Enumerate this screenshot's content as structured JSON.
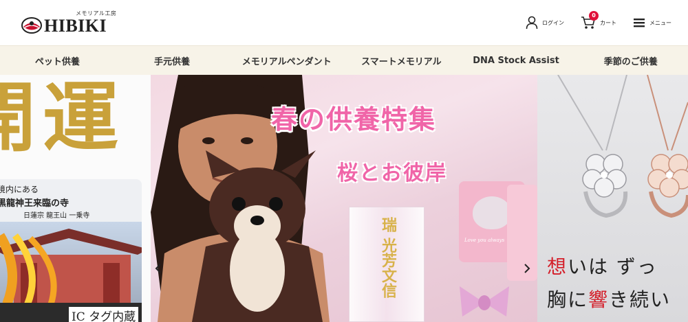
{
  "header": {
    "logo_sub": "メモリアル工房",
    "logo_text": "HIBIKI",
    "login_label": "ログイン",
    "cart_label": "カート",
    "cart_count": "0",
    "menu_label": "メニュー",
    "icons": {
      "login": "user-icon",
      "cart": "cart-icon",
      "menu": "hamburger-icon"
    },
    "accent_color": "#e0103a"
  },
  "nav": {
    "items": [
      {
        "label": "ペット供養"
      },
      {
        "label": "手元供養"
      },
      {
        "label": "メモリアルペンダント"
      },
      {
        "label": "スマートメモリアル"
      },
      {
        "label": "DNA Stock Assist"
      },
      {
        "label": "季節のご供養"
      }
    ],
    "background": "#f7f3e8"
  },
  "hero": {
    "left": {
      "kanji_1": "開",
      "kanji_2": "運",
      "line_1": "境内にある",
      "line_2": "黒龍神王来臨の寺",
      "line_3": "日蓮宗 龍王山 一乗寺",
      "ic_label": "IC タグ内蔵"
    },
    "main": {
      "title": "春の供養特集",
      "subtitle": "桜とお彼岸",
      "crystal_text_1": "瑞",
      "crystal_text_2": "光芳文信",
      "omamori_text": "Love you always",
      "title_color": "#f065a8",
      "prev_icon": "chevron-left-icon",
      "next_icon": "chevron-right-icon"
    },
    "right": {
      "line_1_red": "想",
      "line_1_rest": "いは ずっ",
      "line_2_pre": "胸に",
      "line_2_red": "響",
      "line_2_post": "き続い"
    }
  }
}
